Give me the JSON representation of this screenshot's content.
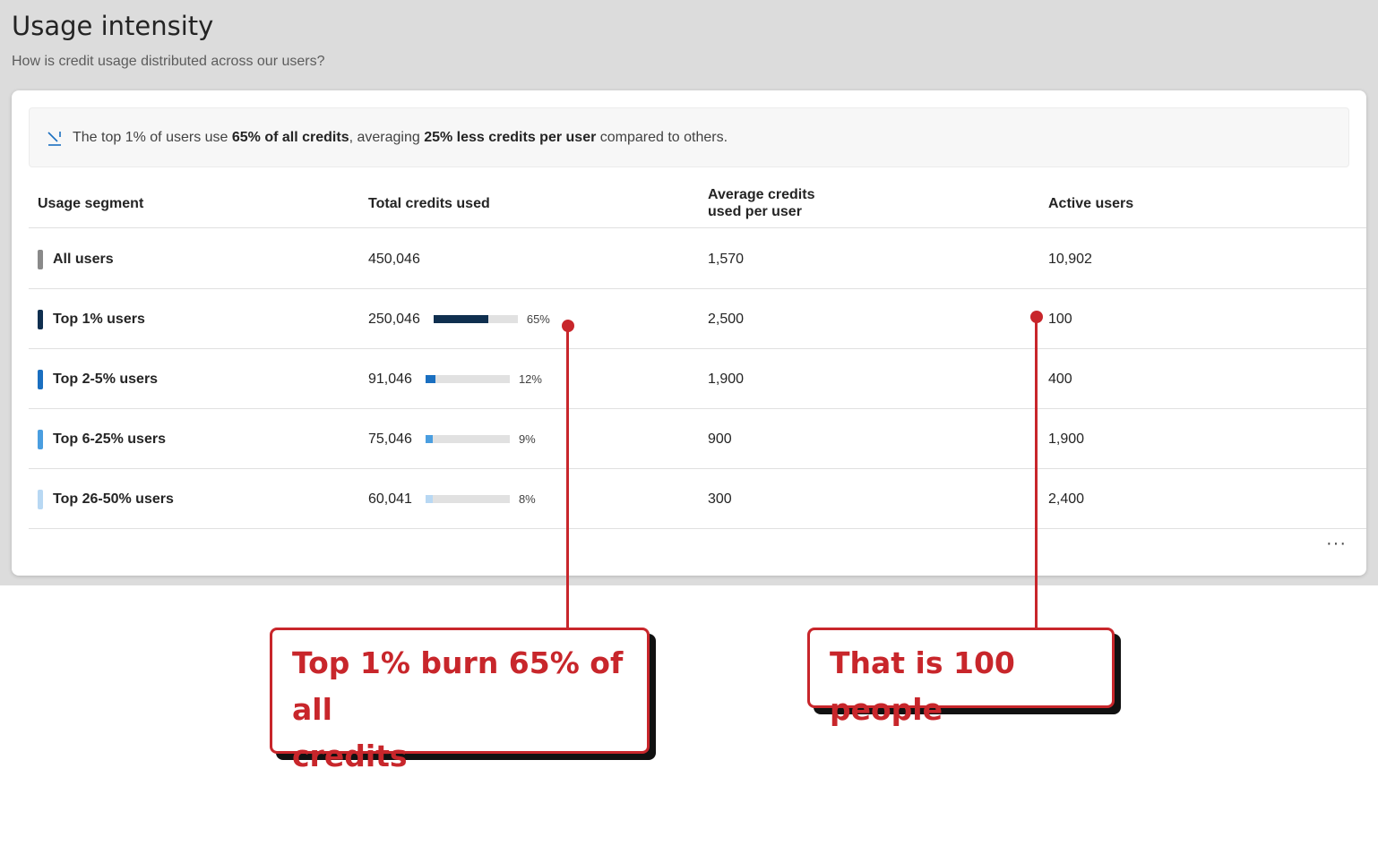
{
  "header": {
    "title": "Usage intensity",
    "subtitle": "How is credit usage distributed across our users?"
  },
  "insight": {
    "icon": "trend-down-icon",
    "text_1": "The top 1% of users use ",
    "bold_1": "65% of all credits",
    "text_2": ", averaging ",
    "bold_2": "25% less credits per user",
    "text_3": " compared to others."
  },
  "table": {
    "columns": {
      "segment": "Usage segment",
      "total": "Total credits used",
      "average_line1": "Average credits",
      "average_line2": "used per user",
      "active": "Active users"
    },
    "rows": [
      {
        "segment": "All users",
        "color": "#8a8a8a",
        "total": "450,046",
        "share": null,
        "share_label": "",
        "average": "1,570",
        "active": "10,902"
      },
      {
        "segment": "Top 1% users",
        "color": "#0f2f4f",
        "total": "250,046",
        "share": 0.65,
        "share_label": "65%",
        "average": "2,500",
        "active": "100"
      },
      {
        "segment": "Top 2-5% users",
        "color": "#1a6fc0",
        "total": "91,046",
        "share": 0.12,
        "share_label": "12%",
        "average": "1,900",
        "active": "400"
      },
      {
        "segment": "Top 6-25% users",
        "color": "#4a9ee0",
        "total": "75,046",
        "share": 0.09,
        "share_label": "9%",
        "average": "900",
        "active": "1,900"
      },
      {
        "segment": "Top 26-50% users",
        "color": "#b8d8f3",
        "total": "60,041",
        "share": 0.08,
        "share_label": "8%",
        "average": "300",
        "active": "2,400"
      }
    ]
  },
  "more_menu": {
    "icon": "more-horizontal-icon",
    "label": "···"
  },
  "annotations": {
    "color": "#c8262b",
    "left_line1": "Top 1% burn 65% of all",
    "left_line2": "credits",
    "right": "That is 100 people"
  }
}
